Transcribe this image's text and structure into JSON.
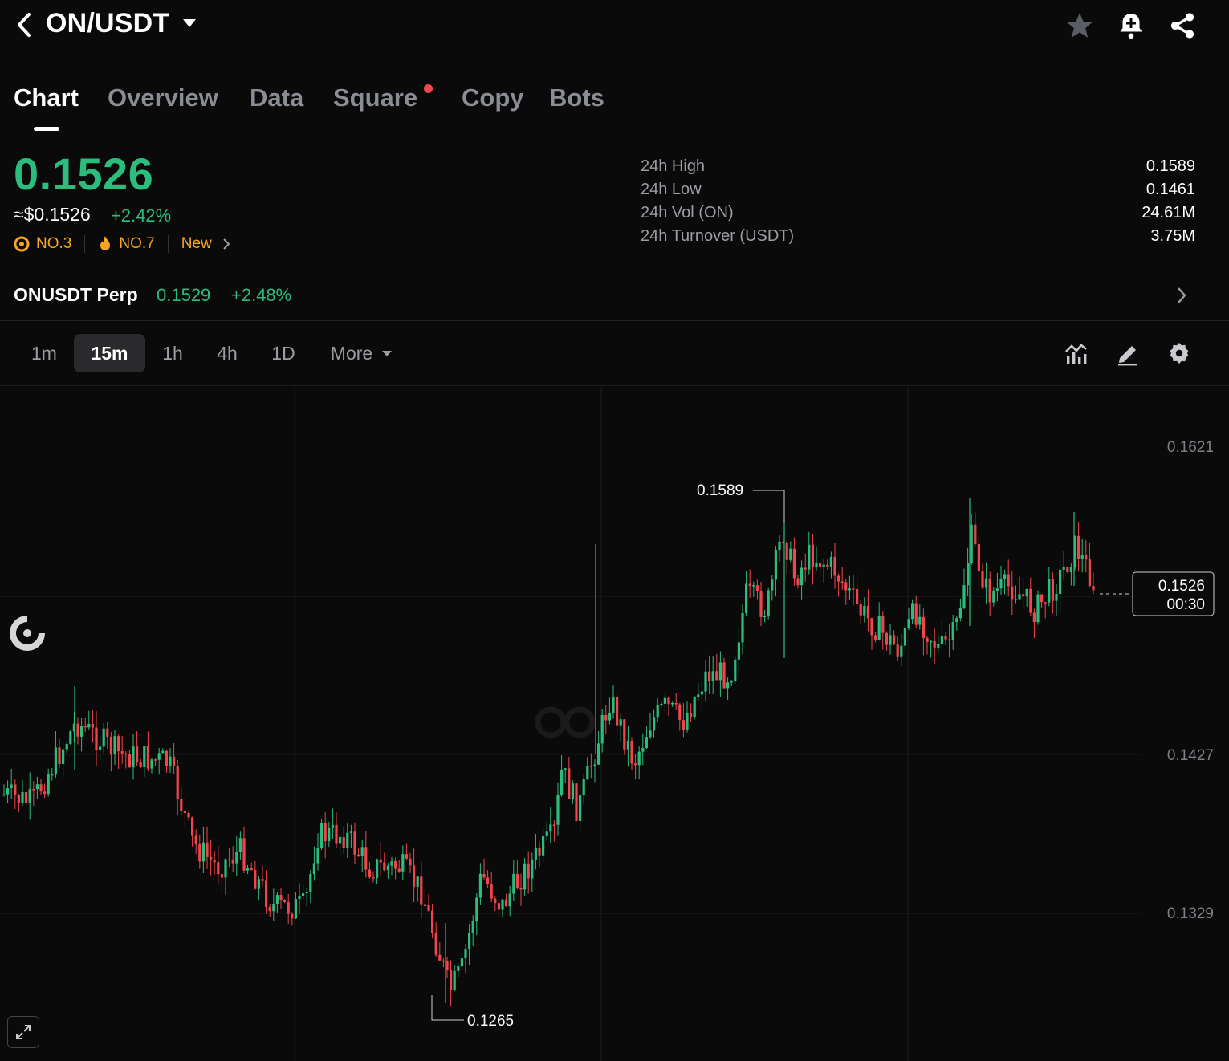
{
  "header": {
    "pair": "ON/USDT",
    "icons": [
      "back-icon",
      "caret-down-icon",
      "star-icon",
      "bell-plus-icon",
      "share-icon"
    ]
  },
  "tabs": [
    {
      "label": "Chart",
      "active": true
    },
    {
      "label": "Overview",
      "active": false
    },
    {
      "label": "Data",
      "active": false
    },
    {
      "label": "Square",
      "active": false,
      "dot": true
    },
    {
      "label": "Copy",
      "active": false
    },
    {
      "label": "Bots",
      "active": false
    }
  ],
  "ticker": {
    "price": "0.1526",
    "usd_price": "≈$0.1526",
    "change": "+2.42%",
    "rank_1": "NO.3",
    "rank_2": "NO.7",
    "new_label": "New",
    "up_color": "#2bbd7e",
    "down_color": "#f0454b"
  },
  "stats": [
    {
      "label": "24h High",
      "value": "0.1589"
    },
    {
      "label": "24h Low",
      "value": "0.1461"
    },
    {
      "label": "24h Vol (ON)",
      "value": "24.61M"
    },
    {
      "label": "24h Turnover (USDT)",
      "value": "3.75M"
    }
  ],
  "perp": {
    "name": "ONUSDT Perp",
    "price": "0.1529",
    "change": "+2.48%"
  },
  "timeframes": {
    "items": [
      "1m",
      "15m",
      "1h",
      "4h",
      "1D"
    ],
    "active": "15m",
    "more_label": "More"
  },
  "chart": {
    "y_ticks": [
      "0.1621",
      "0.1427",
      "0.1329"
    ],
    "high_label": "0.1589",
    "low_label": "0.1265",
    "current_price": "0.1526",
    "countdown": "00:30"
  }
}
